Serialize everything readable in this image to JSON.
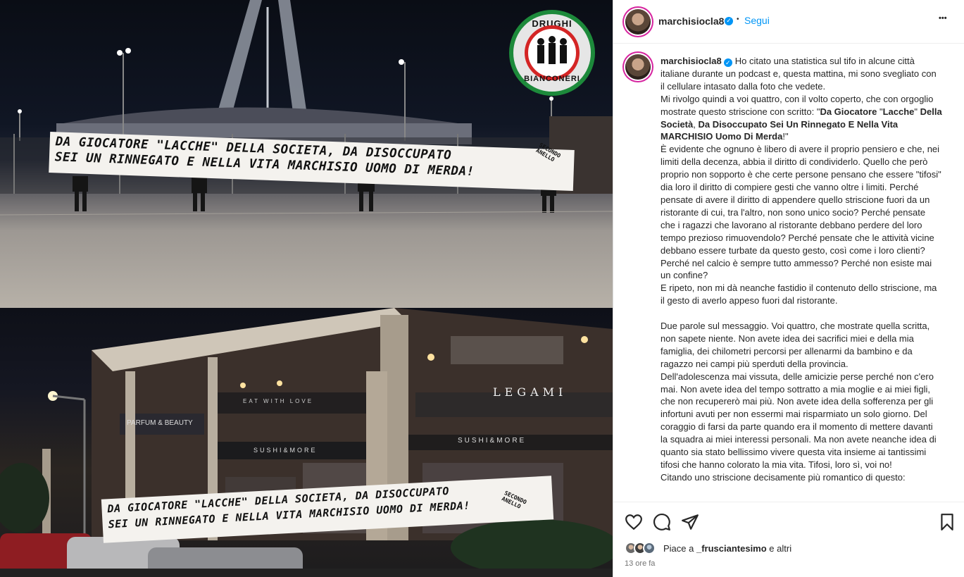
{
  "header": {
    "username": "marchisiocla8",
    "separator": "•",
    "follow_label": "Segui",
    "more_label": "•••"
  },
  "media": {
    "top_banner_line1": "DA GIOCATORE \"LACCHE\" DELLA SOCIETA, DA DISOCCUPATO",
    "top_banner_line2": "SEI UN RINNEGATO E NELLA VITA MARCHISIO UOMO DI MERDA!",
    "top_banner_side": "SECONDO ANELLO",
    "bottom_banner_line1": "DA GIOCATORE \"LACCHE\" DELLA SOCIETA, DA DISOCCUPATO",
    "bottom_banner_line2": "SEI UN RINNEGATO E NELLA VITA MARCHISIO UOMO DI MERDA!",
    "bottom_banner_side": "SECONDO ANELLO",
    "logo_top": "DRUGHI",
    "logo_bottom": "BIANCONERI",
    "sign_legami": "LEGAMI",
    "sign_parfum": "PARFUM & BEAUTY",
    "sign_sushi": "SUSHI&MORE",
    "sign_eat": "EAT WITH LOVE"
  },
  "caption": {
    "username": "marchisiocla8",
    "p1": "Ho citato una statistica sul tifo in alcune città italiane durante un podcast e, questa mattina, mi sono svegliato con il cellulare intasato dalla foto che vedete.",
    "p2_pre": "Mi rivolgo quindi a voi quattro, con il volto coperto, che con orgoglio mostrate questo striscione con scritto: \"",
    "p2_bold_a": "Da Giocatore",
    "p2_mid1": " \"",
    "p2_bold_b": "Lacche",
    "p2_mid2": "\" ",
    "p2_bold_c": "Della Società",
    "p2_mid3": ", ",
    "p2_bold_d": "Da Disoccupato Sei Un Rinnegato E Nella Vita MARCHISIO Uomo Di Merda",
    "p2_post": "!\"",
    "p3": "È evidente che ognuno è libero di avere il proprio pensiero e che, nei limiti della decenza, abbia il diritto di condividerlo. Quello che però proprio non sopporto è che certe persone pensano che essere \"tifosi\" dia loro il diritto di compiere gesti che vanno oltre i limiti. Perché pensate di avere il diritto di appendere quello striscione fuori da un ristorante di cui, tra l'altro, non sono unico socio? Perché pensate che i ragazzi che lavorano al ristorante debbano perdere del loro tempo prezioso rimuovendolo? Perché pensate che le attività vicine debbano essere turbate da questo gesto, così come i loro clienti? Perché nel calcio è sempre tutto ammesso? Perché non esiste mai un confine?",
    "p4": "E ripeto, non mi dà neanche fastidio il contenuto dello striscione, ma il gesto di averlo appeso fuori dal ristorante.",
    "p5": "Due parole sul messaggio. Voi quattro, che mostrate quella scritta, non sapete niente. Non avete idea dei sacrifici miei e della mia famiglia, dei chilometri percorsi per allenarmi da bambino e da ragazzo nei campi più sperduti della provincia.",
    "p6": "Dell'adolescenza mai vissuta, delle amicizie perse perché non c'ero mai. Non avete idea del tempo sottratto a mia moglie e ai miei figli, che non recupererò mai più. Non avete idea della sofferenza per gli infortuni avuti per non essermi mai risparmiato un solo giorno. Del coraggio di farsi da parte quando era il momento di mettere davanti la squadra ai miei interessi personali. Ma non avete neanche idea di quanto sia stato bellissimo vivere questa vita insieme ai tantissimi tifosi che hanno colorato la mia vita. Tifosi, loro sì, voi no!",
    "p7": "Citando uno striscione decisamente più romantico di questo:"
  },
  "actions": {
    "like_icon": "heart-icon",
    "comment_icon": "comment-icon",
    "share_icon": "share-icon",
    "save_icon": "bookmark-icon",
    "likes_prefix": "Piace a ",
    "likes_user": "_frusciantesimo",
    "likes_suffix": " e altri",
    "timestamp": "13 ore fa"
  },
  "colors": {
    "accent": "#0095f6",
    "text": "#262626",
    "muted": "#737373",
    "logo_green": "#1d8a3b",
    "logo_red": "#d42525"
  }
}
